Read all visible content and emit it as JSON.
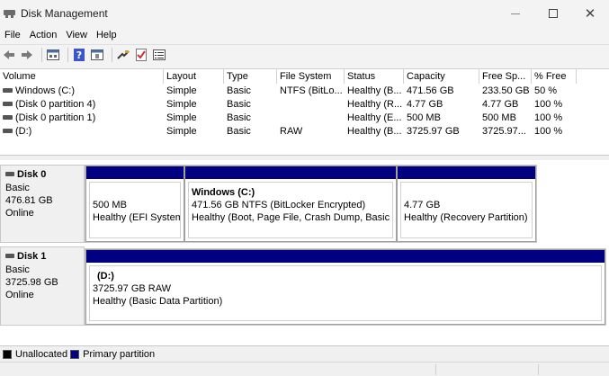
{
  "window": {
    "title": "Disk Management",
    "controls": {
      "minimize": "–",
      "maximize": "☐",
      "close": "✕"
    }
  },
  "menu": [
    "File",
    "Action",
    "View",
    "Help"
  ],
  "toolbar": {
    "icons": [
      "back-icon",
      "forward-icon",
      "properties-icon",
      "help-icon",
      "view-icon",
      "connect-icon",
      "check-icon",
      "list-icon"
    ]
  },
  "volume_table": {
    "columns": [
      "Volume",
      "Layout",
      "Type",
      "File System",
      "Status",
      "Capacity",
      "Free Sp...",
      "% Free"
    ],
    "rows": [
      {
        "volume": "Windows (C:)",
        "layout": "Simple",
        "type": "Basic",
        "fs": "NTFS (BitLo...",
        "status": "Healthy (B...",
        "capacity": "471.56 GB",
        "free": "233.50 GB",
        "pct": "50 %"
      },
      {
        "volume": "(Disk 0 partition 4)",
        "layout": "Simple",
        "type": "Basic",
        "fs": "",
        "status": "Healthy (R...",
        "capacity": "4.77 GB",
        "free": "4.77 GB",
        "pct": "100 %"
      },
      {
        "volume": "(Disk 0 partition 1)",
        "layout": "Simple",
        "type": "Basic",
        "fs": "",
        "status": "Healthy (E...",
        "capacity": "500 MB",
        "free": "500 MB",
        "pct": "100 %"
      },
      {
        "volume": "(D:)",
        "layout": "Simple",
        "type": "Basic",
        "fs": "RAW",
        "status": "Healthy (B...",
        "capacity": "3725.97 GB",
        "free": "3725.97...",
        "pct": "100 %"
      }
    ]
  },
  "disks": [
    {
      "name": "Disk 0",
      "type": "Basic",
      "size": "476.81 GB",
      "state": "Online",
      "partitions": [
        {
          "name": "",
          "size": "500 MB",
          "status": "Healthy (EFI System P"
        },
        {
          "name": "Windows  (C:)",
          "size": "471.56 GB NTFS (BitLocker Encrypted)",
          "status": "Healthy (Boot, Page File, Crash Dump, Basic Dat"
        },
        {
          "name": "",
          "size": "4.77 GB",
          "status": "Healthy (Recovery Partition)"
        }
      ]
    },
    {
      "name": "Disk 1",
      "type": "Basic",
      "size": "3725.98 GB",
      "state": "Online",
      "partitions": [
        {
          "name": "(D:)",
          "size": "3725.97 GB RAW",
          "status": "Healthy (Basic Data Partition)"
        }
      ]
    }
  ],
  "legend": [
    {
      "label": "Unallocated",
      "color": "#000000"
    },
    {
      "label": "Primary partition",
      "color": "#000080"
    }
  ]
}
